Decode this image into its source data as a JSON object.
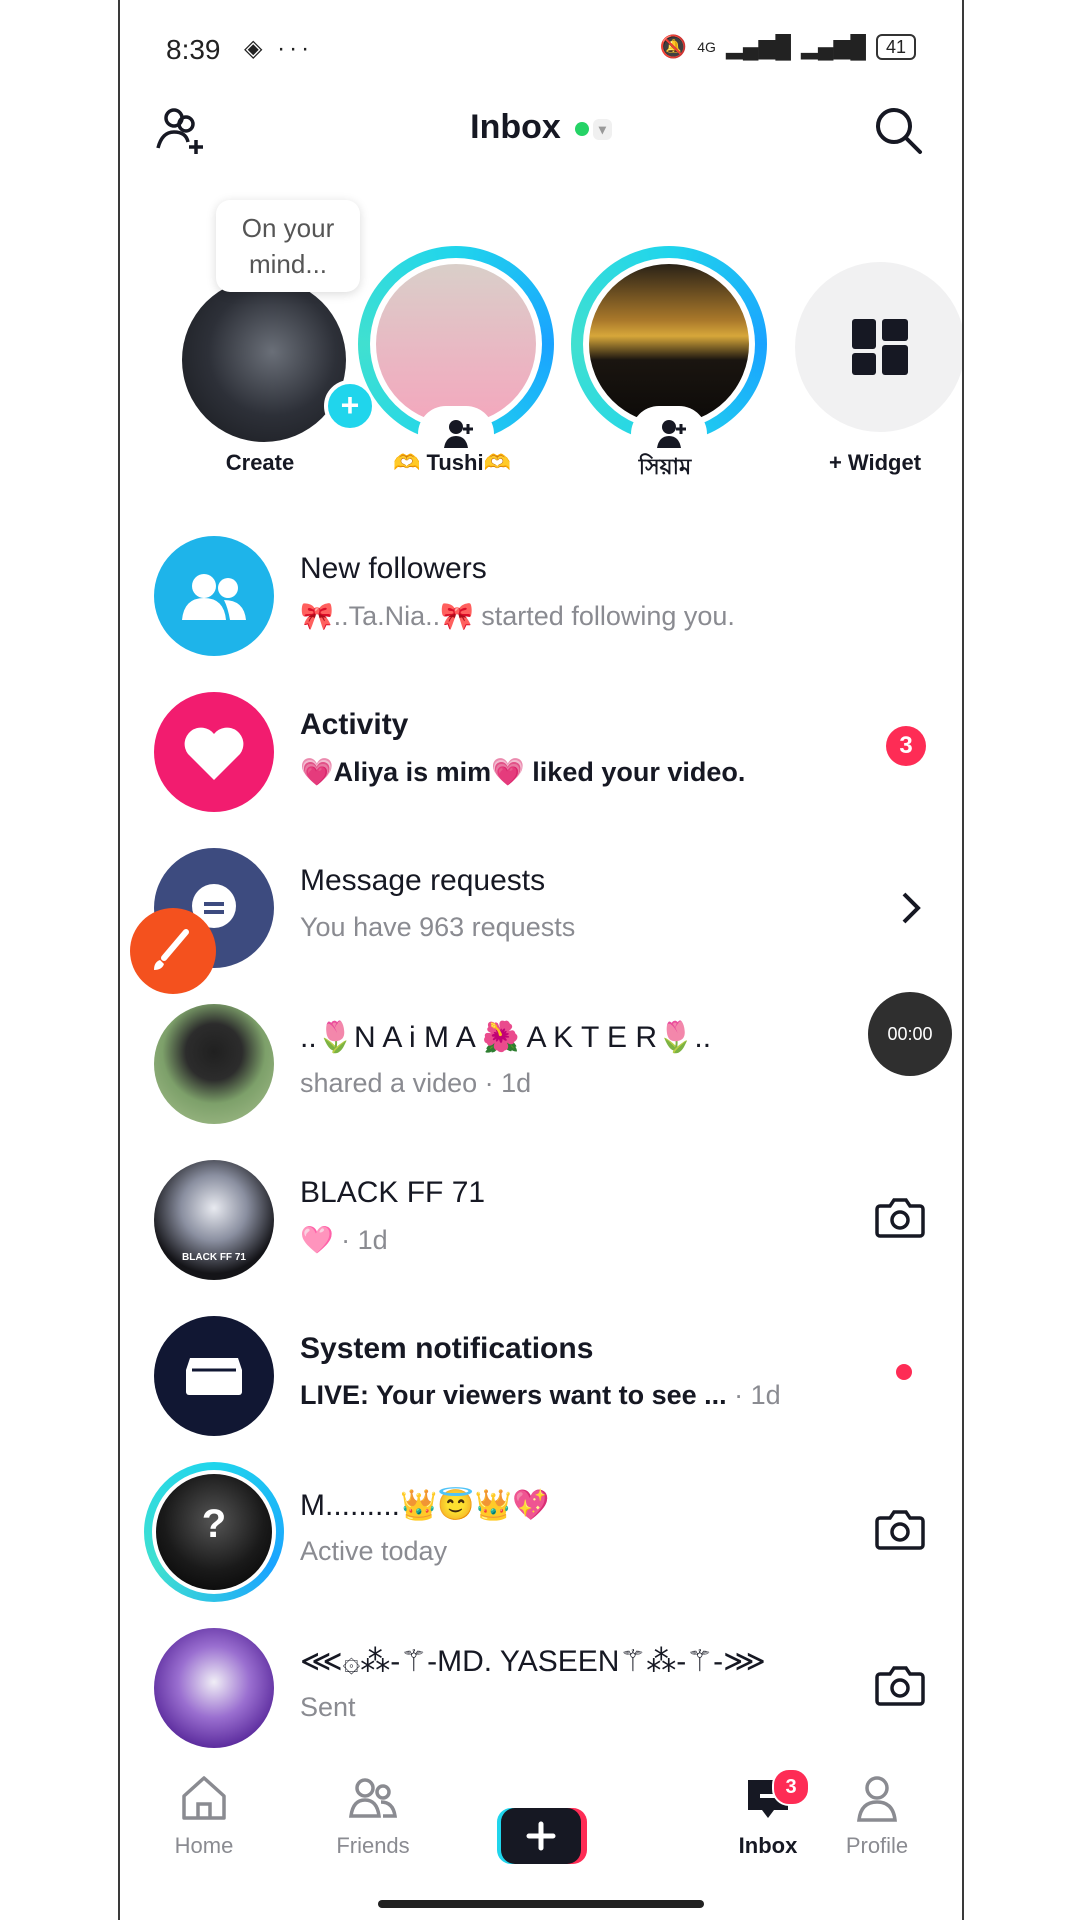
{
  "status": {
    "time": "8:39",
    "network": "4G",
    "battery": "41"
  },
  "header": {
    "title": "Inbox"
  },
  "stories": [
    {
      "label": "Create",
      "bubble": "On your mind..."
    },
    {
      "label": "🫶 Tushi🫶"
    },
    {
      "label": "সিয়াম"
    },
    {
      "label": "+ Widget"
    }
  ],
  "rows": [
    {
      "name": "New followers",
      "sub": "🎀..Ta.Nia..🎀 started following you."
    },
    {
      "name": "Activity",
      "sub": "💗Aliya is mim💗 liked your video.",
      "badge": "3"
    },
    {
      "name": "Message requests",
      "sub": "You have 963 requests"
    },
    {
      "name": "..🌷N A i M A 🌺 A K T E R🌷..",
      "sub": "shared a video · 1d"
    },
    {
      "name": "BLACK FF 71",
      "sub": "🩷 · 1d",
      "avatar_text": "BLACK FF 71"
    },
    {
      "name": "System notifications",
      "sub": "LIVE: Your viewers want to see ...",
      "time": "· 1d"
    },
    {
      "name": "M.........👑😇👑💖",
      "sub": "Active today"
    },
    {
      "name": "⋘۞⁂-⚚-MD. YASEEN⚚⁂-⚚-⋙",
      "sub": "Sent"
    }
  ],
  "timer": "00:00",
  "tabs": {
    "home": "Home",
    "friends": "Friends",
    "inbox": "Inbox",
    "profile": "Profile",
    "inbox_badge": "3"
  },
  "colors": {
    "accent": "#fe2c55",
    "cyan": "#20d5ec",
    "followers": "#1eb4ea",
    "activity": "#f21c6f",
    "requests": "#3d4b7f",
    "system": "#111733"
  }
}
